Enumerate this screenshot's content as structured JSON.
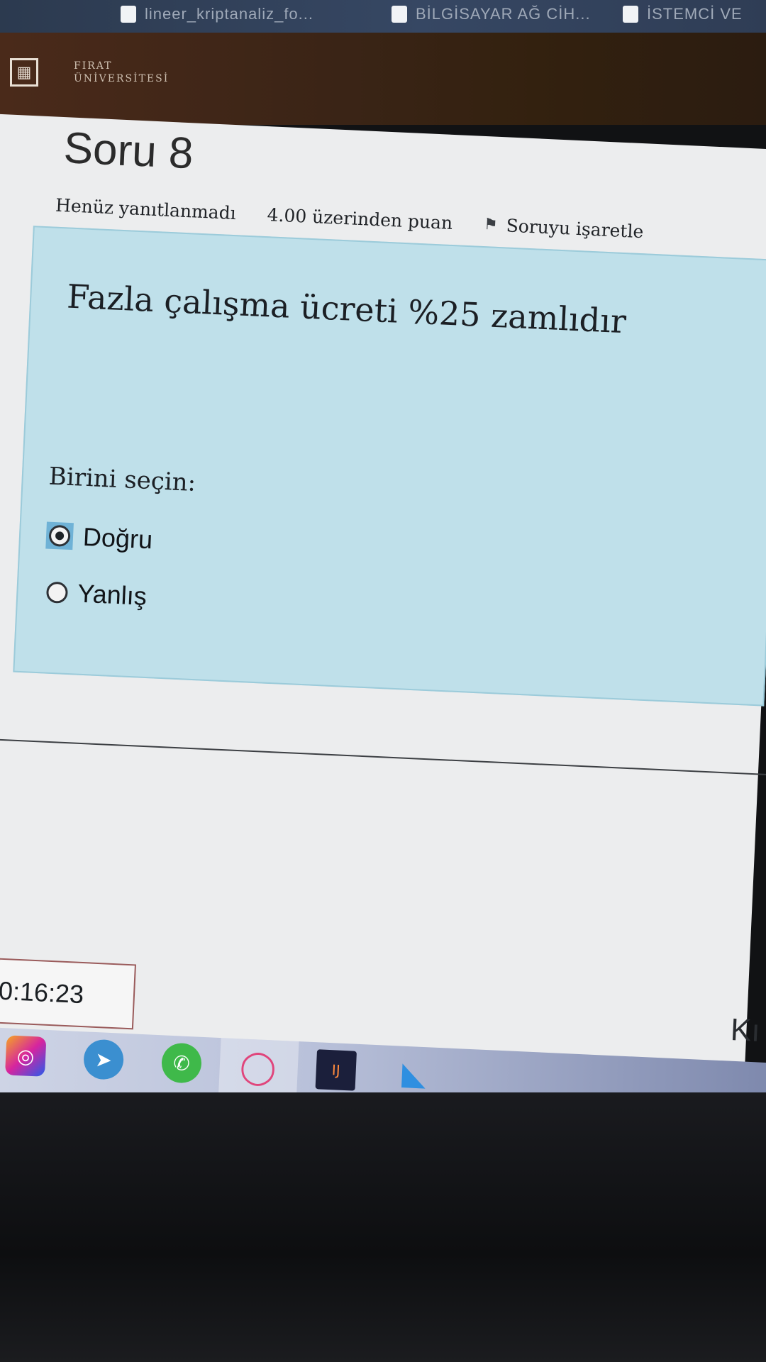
{
  "bookmarks": [
    {
      "label": "lineer_kriptanaliz_fo..."
    },
    {
      "label": "BİLGİSAYAR AĞ CİH..."
    },
    {
      "label": "İSTEMCİ VE"
    }
  ],
  "header": {
    "logo_icon": "university-logo",
    "name_line1": "FIRAT",
    "name_line2": "ÜNİVERSİTESİ"
  },
  "question": {
    "number_label": "Soru 8",
    "status": "Henüz yanıtlanmadı",
    "points": "4.00 üzerinden puan",
    "flag_label": "Soruyu işaretle",
    "flag_icon": "flag-icon",
    "text": "Fazla çalışma ücreti %25 zamlıdır",
    "prompt": "Birini seçin:",
    "options": [
      {
        "label": "Doğru",
        "selected": true
      },
      {
        "label": "Yanlış",
        "selected": false
      }
    ]
  },
  "timer": {
    "value": "0:16:23"
  },
  "navigation": {
    "next_label": "Kı"
  },
  "taskbar": {
    "apps": [
      "instagram-icon",
      "telegram-icon",
      "whatsapp-icon",
      "opera-icon",
      "intellij-icon",
      "vscode-icon"
    ]
  },
  "colors": {
    "question_bg": "#bfe0ea",
    "header_bg": "#3a2416",
    "selected_highlight": "#6fb2d6"
  }
}
